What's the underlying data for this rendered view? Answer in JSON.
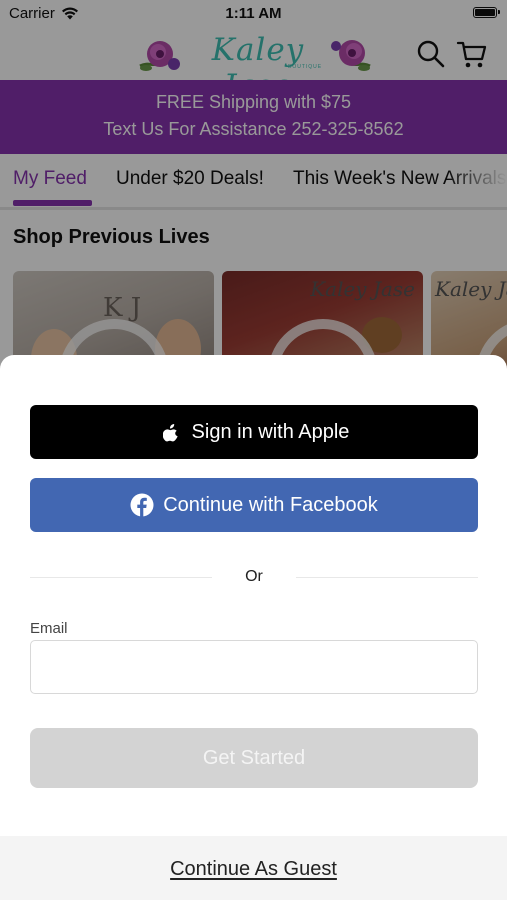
{
  "status_bar": {
    "carrier": "Carrier",
    "time": "1:11 AM"
  },
  "header": {
    "logo_text": "Kaley Jase",
    "logo_subtext": "BOUTIQUE",
    "icons": [
      "search-icon",
      "cart-icon"
    ]
  },
  "promo": {
    "line1": "FREE Shipping with $75",
    "line2": "Text Us For Assistance 252-325-8562"
  },
  "tabs": [
    {
      "label": "My Feed",
      "active": true
    },
    {
      "label": "Under $20 Deals!",
      "active": false
    },
    {
      "label": "This Week's New Arrivals",
      "active": false
    }
  ],
  "feed": {
    "section_title": "Shop Previous Lives",
    "cards": [
      {
        "watermark": "K J"
      },
      {
        "watermark": "Kaley Jase"
      },
      {
        "watermark": "Kaley Jase"
      }
    ]
  },
  "sheet": {
    "apple_label": "Sign in with Apple",
    "facebook_label": "Continue with Facebook",
    "divider_text": "Or",
    "email_label": "Email",
    "email_value": "",
    "email_placeholder": "",
    "start_label": "Get Started",
    "guest_label": "Continue As Guest"
  },
  "colors": {
    "brand_purple": "#8532ad",
    "facebook_blue": "#4267b2",
    "apple_black": "#000000",
    "logo_teal": "#3fbfb2",
    "disabled_gray": "#d3d3d3"
  }
}
